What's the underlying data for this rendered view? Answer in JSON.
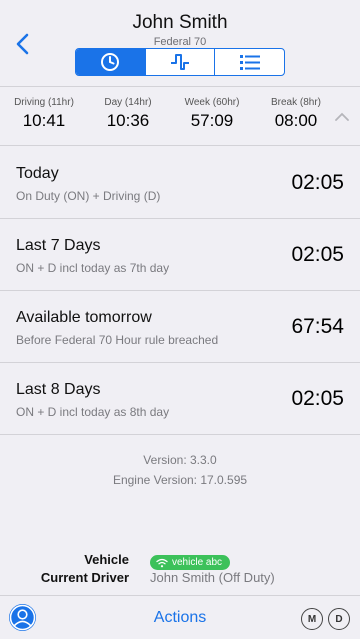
{
  "header": {
    "title": "John Smith",
    "subtitle": "Federal 70",
    "back_icon": "chevron-left-icon",
    "tabs": [
      {
        "icon": "clock-icon",
        "active": true
      },
      {
        "icon": "log-graph-icon",
        "active": false
      },
      {
        "icon": "list-icon",
        "active": false
      }
    ]
  },
  "timers": [
    {
      "label": "Driving (11hr)",
      "value": "10:41"
    },
    {
      "label": "Day (14hr)",
      "value": "10:36"
    },
    {
      "label": "Week (60hr)",
      "value": "57:09"
    },
    {
      "label": "Break (8hr)",
      "value": "08:00"
    }
  ],
  "summary": [
    {
      "title": "Today",
      "subtitle": "On Duty (ON) + Driving (D)",
      "value": "02:05"
    },
    {
      "title": "Last 7 Days",
      "subtitle": "ON + D incl today as 7th day",
      "value": "02:05"
    },
    {
      "title": "Available tomorrow",
      "subtitle": "Before Federal 70 Hour rule breached",
      "value": "67:54"
    },
    {
      "title": "Last 8 Days",
      "subtitle": "ON + D incl today as 8th day",
      "value": "02:05"
    }
  ],
  "version": {
    "app": "Version: 3.3.0",
    "engine": "Engine Version: 17.0.595"
  },
  "vehicle": {
    "label": "Vehicle",
    "value": "vehicle abc",
    "status_color": "#3cc15a"
  },
  "driver": {
    "label": "Current Driver",
    "value": "John Smith (Off Duty)"
  },
  "footer": {
    "actions_label": "Actions",
    "m_label": "M",
    "d_label": "D"
  },
  "colors": {
    "accent": "#1a73e8",
    "background": "#f0eff4"
  }
}
